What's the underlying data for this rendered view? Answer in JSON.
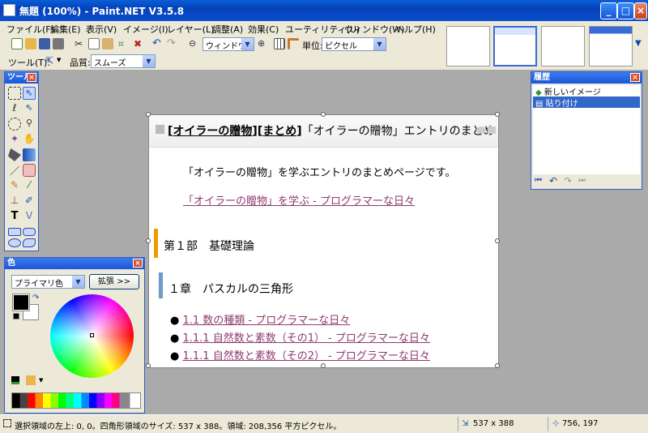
{
  "window": {
    "title": "無題 (100%) - Paint.NET V3.5.8"
  },
  "menu": [
    "ファイル(F)",
    "編集(E)",
    "表示(V)",
    "イメージ(I)",
    "レイヤー(L)",
    "調整(A)",
    "効果(C)",
    "ユーティリティ(U)",
    "ウィンドウ(W)",
    "ヘルプ(H)"
  ],
  "toolbar": {
    "zoom_value": "ウィンドウ",
    "units_label": "単位:",
    "units_value": "ピクセル",
    "tool_label": "ツール(T):",
    "quality_label": "品質:",
    "quality_value": "スムーズ"
  },
  "tools_panel": {
    "title": "ツール"
  },
  "colors_panel": {
    "title": "色",
    "mode": "プライマリ色",
    "expand": "拡張 >>"
  },
  "history_panel": {
    "title": "履歴",
    "items": [
      "新しいイメージ",
      "貼り付け"
    ]
  },
  "canvas": {
    "heading_parts": [
      "[",
      "オイラーの贈物",
      "]",
      "[",
      "まとめ",
      "]",
      "「オイラーの贈物」エントリのまとめ"
    ],
    "intro": "「オイラーの贈物」を学ぶエントリのまとめページです。",
    "intro_link": "「オイラーの贈物」を学ぶ - プログラマーな日々",
    "part_title": "第１部　基礎理論",
    "chapter_title": "１章　パスカルの三角形",
    "list": [
      "1.1 数の種類 - プログラマーな日々",
      "1.1.1 自然数と素数（その1） - プログラマーな日々",
      "1.1.1 自然数と素数（その2） - プログラマーな日々"
    ]
  },
  "status": {
    "selection": "選択領域の左上: 0, 0。四角形領域のサイズ: 537 x 388。領域: 208,356 平方ピクセル。",
    "size": "537 x 388",
    "cursor": "756, 197"
  }
}
